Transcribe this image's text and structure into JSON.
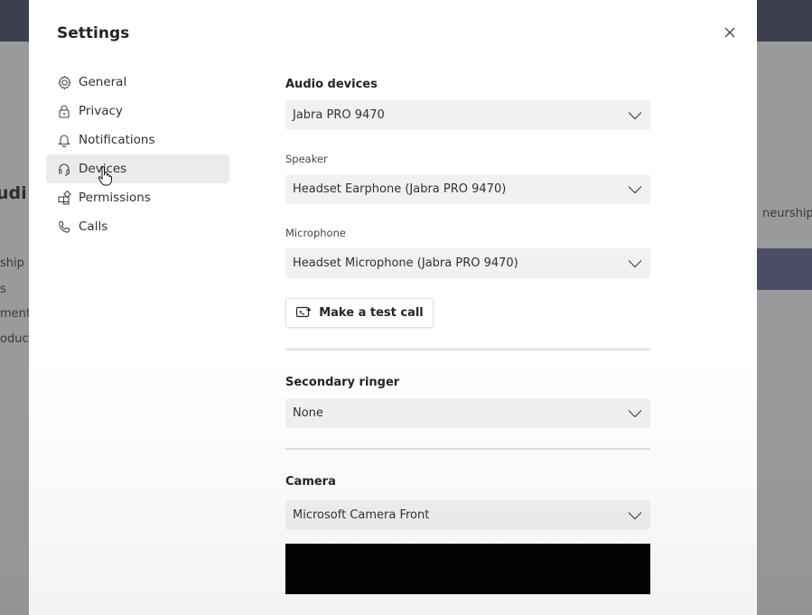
{
  "background": {
    "left_texts": [
      "udi",
      "ship",
      "s",
      "ment",
      "oduct"
    ],
    "right_text": "neurship"
  },
  "settings": {
    "title": "Settings",
    "close_icon": "close-icon",
    "nav": [
      {
        "label": "General",
        "icon": "gear-icon",
        "active": false
      },
      {
        "label": "Privacy",
        "icon": "lock-icon",
        "active": false
      },
      {
        "label": "Notifications",
        "icon": "bell-icon",
        "active": false
      },
      {
        "label": "Devices",
        "icon": "headset-icon",
        "active": true
      },
      {
        "label": "Permissions",
        "icon": "apps-icon",
        "active": false
      },
      {
        "label": "Calls",
        "icon": "phone-icon",
        "active": false
      }
    ]
  },
  "devices": {
    "audio_devices": {
      "title": "Audio devices",
      "value": "Jabra PRO 9470"
    },
    "speaker": {
      "label": "Speaker",
      "value": "Headset Earphone (Jabra PRO 9470)"
    },
    "microphone": {
      "label": "Microphone",
      "value": "Headset Microphone (Jabra PRO 9470)"
    },
    "test_call_label": "Make a test call",
    "secondary_ringer": {
      "title": "Secondary ringer",
      "value": "None"
    },
    "camera": {
      "title": "Camera",
      "value": "Microsoft Camera Front"
    }
  },
  "colors": {
    "modal_bg": "#ffffff",
    "active_nav_bg": "#ebebeb",
    "dropdown_bg": "#f1f1f1",
    "topbar": "#3b3e4f"
  }
}
